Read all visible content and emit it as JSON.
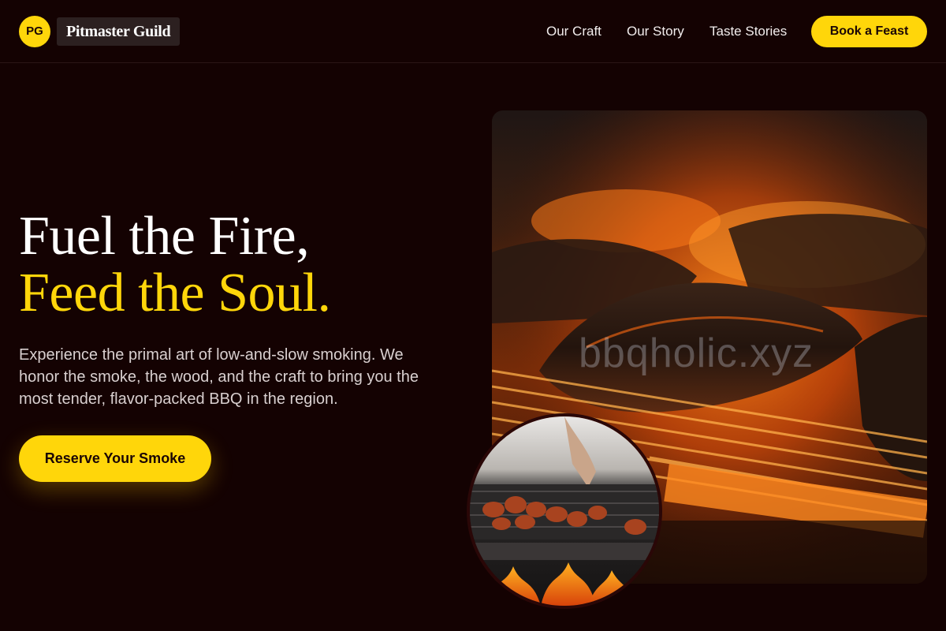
{
  "brand": {
    "initials": "PG",
    "name": "Pitmaster Guild"
  },
  "nav": {
    "items": [
      "Our Craft",
      "Our Story",
      "Taste Stories"
    ],
    "cta_label": "Book a Feast"
  },
  "hero": {
    "headline_line1": "Fuel the Fire,",
    "headline_line2": "Feed the Soul.",
    "description": "Experience the primal art of low-and-slow smoking. We honor the smoke, the wood, and the craft to bring you the most tender, flavor-packed BBQ in the region.",
    "cta_label": "Reserve Your Smoke",
    "main_image": "photo of smoked ribs on a glowing grill",
    "inset_image": "photo of meat skewers on a grill with flames",
    "watermark": "bbqholic.xyz"
  },
  "colors": {
    "background": "#140202",
    "accent": "#ffd60a",
    "text": "#ffffff"
  }
}
